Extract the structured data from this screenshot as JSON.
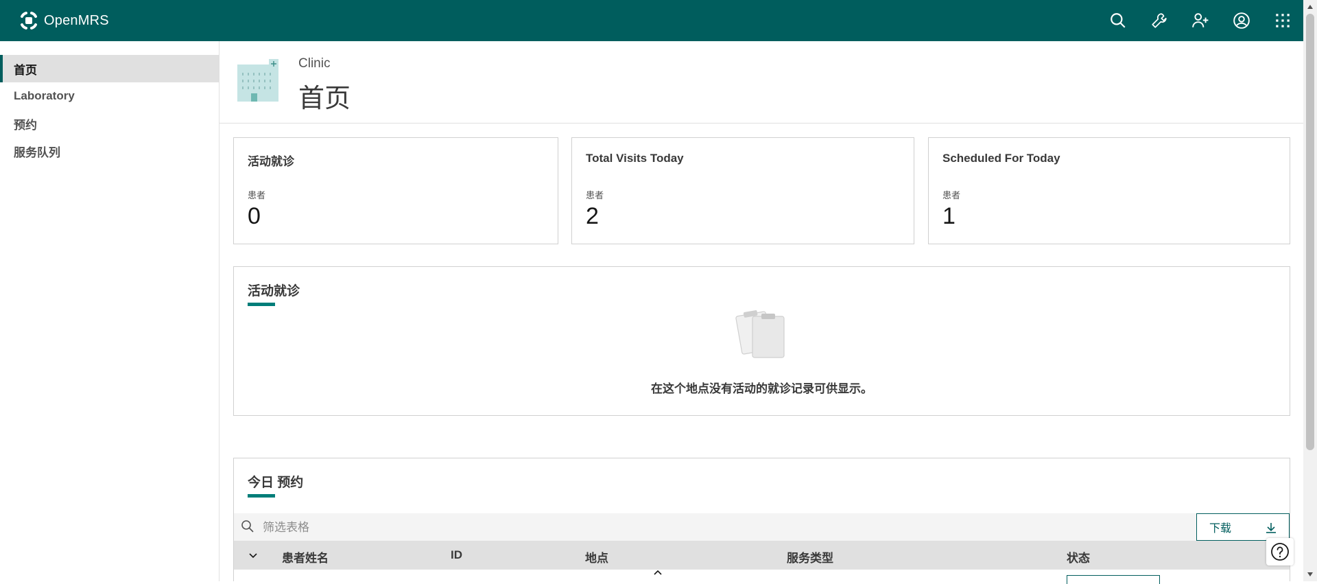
{
  "app": {
    "brand": "OpenMRS",
    "accent": "#005d5d",
    "top_icons": [
      "search-icon",
      "wrench-icon",
      "add-user-icon",
      "user-avatar-icon",
      "app-menu-icon"
    ]
  },
  "sidebar": {
    "items": [
      {
        "label": "首页",
        "active": true
      },
      {
        "label": "Laboratory"
      },
      {
        "label": "预约"
      },
      {
        "label": "服务队列"
      }
    ]
  },
  "header": {
    "location": "Clinic",
    "title": "首页"
  },
  "metrics": [
    {
      "title": "活动就诊",
      "label": "患者",
      "value": "0"
    },
    {
      "title": "Total Visits Today",
      "label": "患者",
      "value": "2"
    },
    {
      "title": "Scheduled For Today",
      "label": "患者",
      "value": "1"
    }
  ],
  "active_visits": {
    "title": "活动就诊",
    "empty_message": "在这个地点没有活动的就诊记录可供显示。"
  },
  "appointments": {
    "title": "今日 预约",
    "search_placeholder": "筛选表格",
    "download_label": "下载",
    "columns": [
      "患者姓名",
      "ID",
      "地点",
      "服务类型",
      "状态"
    ]
  },
  "help": {
    "label": "?"
  }
}
